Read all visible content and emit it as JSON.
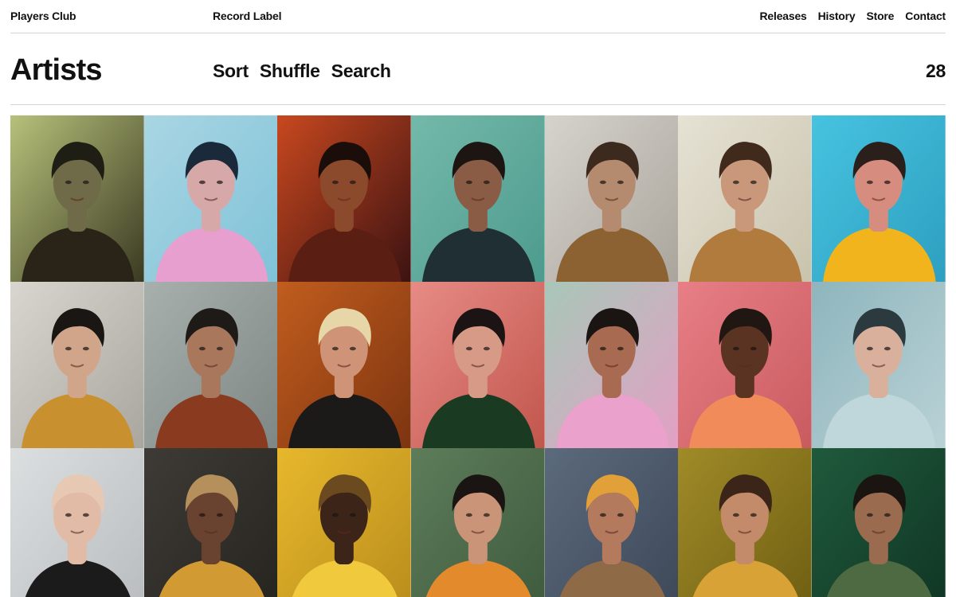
{
  "header": {
    "brand": "Players Club",
    "section": "Record Label",
    "nav": [
      "Releases",
      "History",
      "Store",
      "Contact"
    ]
  },
  "page": {
    "title": "Artists",
    "controls": [
      "Sort",
      "Shuffle",
      "Search"
    ],
    "count": "28"
  },
  "artists": [
    {
      "bg": "#b7c17a",
      "bg2": "#3a3a22",
      "skin": "#6f6a48",
      "hair": "#1e1e14",
      "cloth": "#2a2418"
    },
    {
      "bg": "#a9d6e3",
      "bg2": "#7fc2d8",
      "skin": "#d7a8a8",
      "hair": "#1b2a3a",
      "cloth": "#e79fcf"
    },
    {
      "bg": "#c8481f",
      "bg2": "#3c1212",
      "skin": "#8c4a2c",
      "hair": "#1a0d0a",
      "cloth": "#5a1e12"
    },
    {
      "bg": "#74b9aa",
      "bg2": "#4d9b8e",
      "skin": "#8a5b45",
      "hair": "#1c1512",
      "cloth": "#1f2f33"
    },
    {
      "bg": "#d6d3cd",
      "bg2": "#aaa59c",
      "skin": "#b58b6f",
      "hair": "#3d2a1e",
      "cloth": "#8c6232"
    },
    {
      "bg": "#e6e2d4",
      "bg2": "#c9c3ad",
      "skin": "#c9977a",
      "hair": "#3f2a1c",
      "cloth": "#b07b3d"
    },
    {
      "bg": "#46c3e0",
      "bg2": "#2e9fc0",
      "skin": "#d78c80",
      "hair": "#2a1f1a",
      "cloth": "#f2b41c"
    },
    {
      "bg": "#d8d6cf",
      "bg2": "#a9a69e",
      "skin": "#d1a58a",
      "hair": "#1a1614",
      "cloth": "#c8902e"
    },
    {
      "bg": "#a8b0ae",
      "bg2": "#7f8785",
      "skin": "#a9775c",
      "hair": "#1e1a18",
      "cloth": "#8a3a1e"
    },
    {
      "bg": "#c15d1e",
      "bg2": "#7d3410",
      "skin": "#cf9478",
      "hair": "#e7d6a8",
      "cloth": "#1c1a18"
    },
    {
      "bg": "#e78b86",
      "bg2": "#c1564c",
      "skin": "#d79a86",
      "hair": "#1c1414",
      "cloth": "#1a3a22"
    },
    {
      "bg": "#a8c7b8",
      "bg2": "#e3a0c4",
      "skin": "#a96a52",
      "hair": "#1a1412",
      "cloth": "#eaa1cb"
    },
    {
      "bg": "#e87f86",
      "bg2": "#c85b60",
      "skin": "#5a3323",
      "hair": "#201612",
      "cloth": "#f18c5a"
    },
    {
      "bg": "#8eb5bd",
      "bg2": "#b9d2d6",
      "skin": "#d9b09c",
      "hair": "#2b3a3e",
      "cloth": "#bfd6db"
    },
    {
      "bg": "#dcdfe0",
      "bg2": "#b8bcbe",
      "skin": "#e2bba6",
      "hair": "#e7c9b3",
      "cloth": "#1b1b1b"
    },
    {
      "bg": "#3e3b37",
      "bg2": "#26241f",
      "skin": "#6a4230",
      "hair": "#b58f5c",
      "cloth": "#d29a33"
    },
    {
      "bg": "#e7b82c",
      "bg2": "#b98c1c",
      "skin": "#3d2418",
      "hair": "#6a4a1e",
      "cloth": "#f0c93c"
    },
    {
      "bg": "#5d7d5a",
      "bg2": "#3f5a3e",
      "skin": "#c99477",
      "hair": "#1a1512",
      "cloth": "#e38a2c"
    },
    {
      "bg": "#5b6a7c",
      "bg2": "#3d4858",
      "skin": "#b37a5e",
      "hair": "#e2a038",
      "cloth": "#8f6a46"
    },
    {
      "bg": "#a08b28",
      "bg2": "#6e5e12",
      "skin": "#c38b6a",
      "hair": "#3a2518",
      "cloth": "#d9a236"
    },
    {
      "bg": "#1f5a3c",
      "bg2": "#103524",
      "skin": "#9b6b50",
      "hair": "#1a1510",
      "cloth": "#4d6a42"
    }
  ]
}
